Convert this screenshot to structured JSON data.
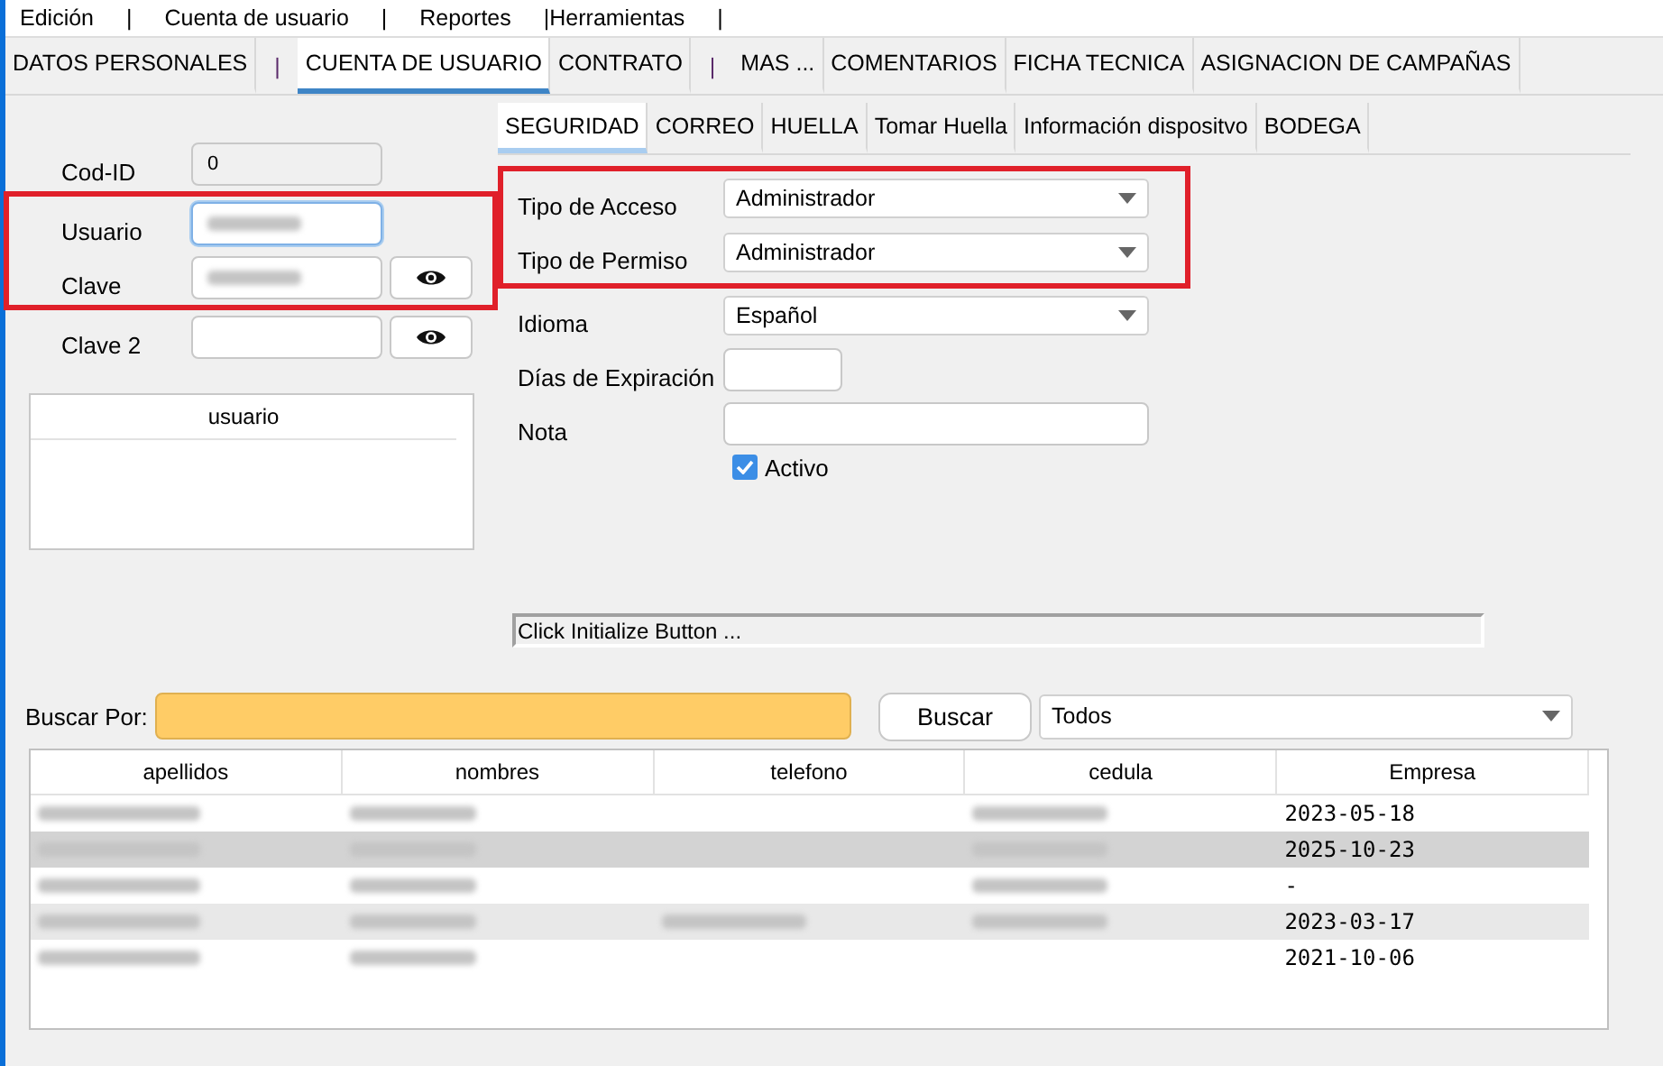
{
  "menu": [
    "Edición",
    "|",
    "Cuenta de usuario",
    "|",
    "Reportes",
    "|Herramientas",
    "|"
  ],
  "tabs": [
    {
      "kind": "tab",
      "label": "DATOS PERSONALES",
      "selected": false
    },
    {
      "kind": "separator",
      "label": "|"
    },
    {
      "kind": "tab",
      "label": "CUENTA DE USUARIO",
      "selected": true
    },
    {
      "kind": "tab",
      "label": "CONTRATO",
      "selected": false
    },
    {
      "kind": "separator",
      "label": "|"
    },
    {
      "kind": "tab",
      "label": "MAS ...",
      "selected": false
    },
    {
      "kind": "tab",
      "label": "COMENTARIOS",
      "selected": false
    },
    {
      "kind": "tab",
      "label": "FICHA TECNICA",
      "selected": false
    },
    {
      "kind": "tab",
      "label": "ASIGNACION DE CAMPAÑAS",
      "selected": false
    }
  ],
  "account": {
    "cod_id": {
      "label": "Cod-ID",
      "value": "0"
    },
    "credentials": {
      "highlighted": true,
      "fields": [
        {
          "label": "Usuario",
          "redacted": true,
          "focused": true,
          "reveal": false
        },
        {
          "label": "Clave",
          "redacted": true,
          "focused": false,
          "reveal": true
        }
      ]
    },
    "clave2": {
      "label": "Clave 2",
      "reveal": true
    },
    "user_list": {
      "column": "usuario"
    }
  },
  "subtabs": [
    {
      "label": "SEGURIDAD",
      "selected": true
    },
    {
      "label": "CORREO",
      "selected": false
    },
    {
      "label": "HUELLA",
      "selected": false
    },
    {
      "label": "Tomar Huella",
      "selected": false
    },
    {
      "label": "Información dispositvo",
      "selected": false
    },
    {
      "label": "BODEGA",
      "selected": false
    }
  ],
  "security": {
    "highlighted": true,
    "selects": [
      {
        "label": "Tipo de Acceso",
        "value": "Administrador"
      },
      {
        "label": "Tipo de Permiso",
        "value": "Administrador"
      }
    ]
  },
  "idioma": {
    "label": "Idioma",
    "value": "Español"
  },
  "dias": {
    "label": "Días de Expiración"
  },
  "nota": {
    "label": "Nota"
  },
  "activo": {
    "label": "Activo",
    "checked": true
  },
  "status": "Click Initialize Button ...",
  "search": {
    "label": "Buscar Por:",
    "button": "Buscar",
    "filter": "Todos"
  },
  "table": {
    "columns": [
      "apellidos",
      "nombres",
      "telefono",
      "cedula",
      "Empresa"
    ],
    "rows": [
      {
        "selected": false,
        "cells": [
          {
            "kind": "redacted"
          },
          {
            "kind": "redacted"
          },
          {
            "kind": "empty"
          },
          {
            "kind": "redacted"
          },
          {
            "kind": "text",
            "text": "2023-05-18"
          }
        ]
      },
      {
        "selected": true,
        "cells": [
          {
            "kind": "redacted"
          },
          {
            "kind": "redacted"
          },
          {
            "kind": "empty"
          },
          {
            "kind": "redacted"
          },
          {
            "kind": "text",
            "text": "2025-10-23"
          }
        ]
      },
      {
        "selected": false,
        "cells": [
          {
            "kind": "redacted"
          },
          {
            "kind": "redacted"
          },
          {
            "kind": "empty"
          },
          {
            "kind": "redacted"
          },
          {
            "kind": "text",
            "text": "-"
          }
        ]
      },
      {
        "selected": false,
        "cells": [
          {
            "kind": "redacted"
          },
          {
            "kind": "redacted"
          },
          {
            "kind": "redacted"
          },
          {
            "kind": "redacted"
          },
          {
            "kind": "text",
            "text": "2023-03-17"
          }
        ]
      },
      {
        "selected": false,
        "cells": [
          {
            "kind": "redacted"
          },
          {
            "kind": "redacted"
          },
          {
            "kind": "empty"
          },
          {
            "kind": "empty"
          },
          {
            "kind": "text",
            "text": "2021-10-06"
          }
        ]
      }
    ]
  }
}
